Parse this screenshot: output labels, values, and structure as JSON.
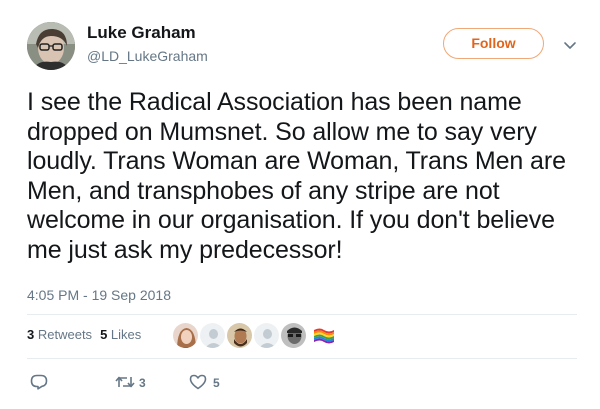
{
  "user": {
    "name": "Luke Graham",
    "handle": "@LD_LukeGraham"
  },
  "follow_button": {
    "label": "Follow"
  },
  "tweet": {
    "text": "I see the Radical Association has been name dropped on Mumsnet. So allow me to say very loudly. Trans Woman are Woman, Trans Men are Men, and transphobes of any stripe are not welcome in our organisation.  If you don't believe me just ask my predecessor!",
    "timestamp": "4:05 PM - 19 Sep 2018"
  },
  "stats": {
    "retweets_count": "3",
    "retweets_label": "Retweets",
    "likes_count": "5",
    "likes_label": "Likes"
  },
  "actions": {
    "reply_count": "",
    "retweet_count": "3",
    "like_count": "5"
  },
  "colors": {
    "accent": "#e0651c",
    "secondary_text": "#657786",
    "primary_text": "#14171a",
    "divider": "#e6ecf0"
  },
  "icons": {
    "more": "chevron-down-icon",
    "reply": "reply-icon",
    "retweet": "retweet-icon",
    "like": "heart-icon"
  }
}
